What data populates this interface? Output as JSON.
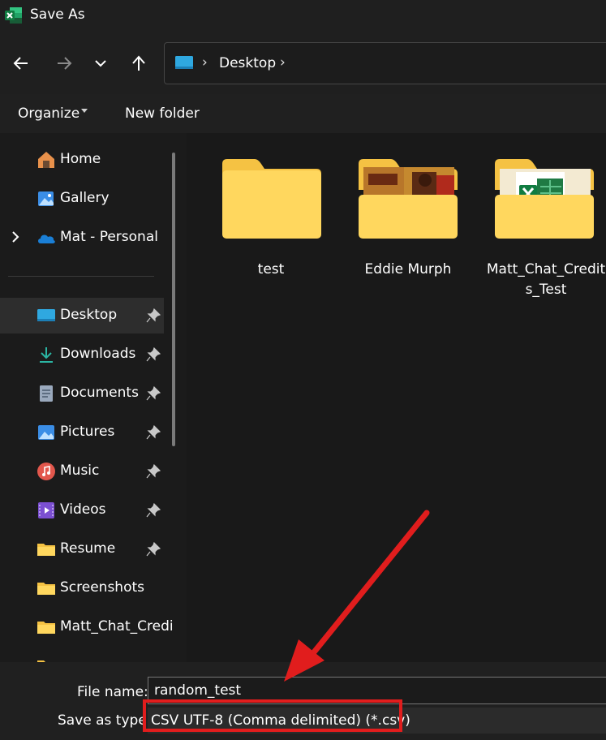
{
  "window": {
    "title": "Save As",
    "app_icon": "excel-icon"
  },
  "nav": {
    "back_icon": "arrow-left-icon",
    "forward_icon": "arrow-right-icon",
    "recent_icon": "chevron-down-icon",
    "up_icon": "arrow-up-icon"
  },
  "address": {
    "sep1": "›",
    "location": "Desktop",
    "sep2": "›"
  },
  "toolbar": {
    "organize_label": "Organize",
    "new_folder_label": "New folder"
  },
  "sidebar": {
    "top_items": [
      {
        "label": "Home",
        "icon": "home-icon"
      },
      {
        "label": "Gallery",
        "icon": "gallery-icon"
      },
      {
        "label": "Mat - Personal",
        "icon": "onedrive-cloud-icon"
      }
    ],
    "quick_items": [
      {
        "label": "Desktop",
        "icon": "desktop-icon",
        "pinned": true,
        "selected": true
      },
      {
        "label": "Downloads",
        "icon": "download-icon",
        "pinned": true
      },
      {
        "label": "Documents",
        "icon": "document-icon",
        "pinned": true
      },
      {
        "label": "Pictures",
        "icon": "pictures-icon",
        "pinned": true
      },
      {
        "label": "Music",
        "icon": "music-icon",
        "pinned": true
      },
      {
        "label": "Videos",
        "icon": "videos-icon",
        "pinned": true
      },
      {
        "label": "Resume",
        "icon": "folder-icon",
        "pinned": true
      },
      {
        "label": "Screenshots",
        "icon": "folder-icon",
        "pinned": false
      },
      {
        "label": "Matt_Chat_Credi",
        "icon": "folder-icon",
        "pinned": false
      }
    ]
  },
  "files": [
    {
      "name": "test",
      "type": "folder"
    },
    {
      "name": "Eddie Murph",
      "type": "folder-with-image"
    },
    {
      "name": "Matt_Chat_Credits_Test",
      "type": "folder-with-excel"
    }
  ],
  "form": {
    "file_name_label": "File name:",
    "file_name_value": "random_test",
    "save_type_label": "Save as type:",
    "save_type_value": "CSV UTF-8 (Comma delimited) (*.csv)"
  },
  "colors": {
    "annotation": "#e11d1d",
    "folder_front": "#ffd75e",
    "folder_back": "#f5c243",
    "excel_green": "#1f7a44"
  }
}
